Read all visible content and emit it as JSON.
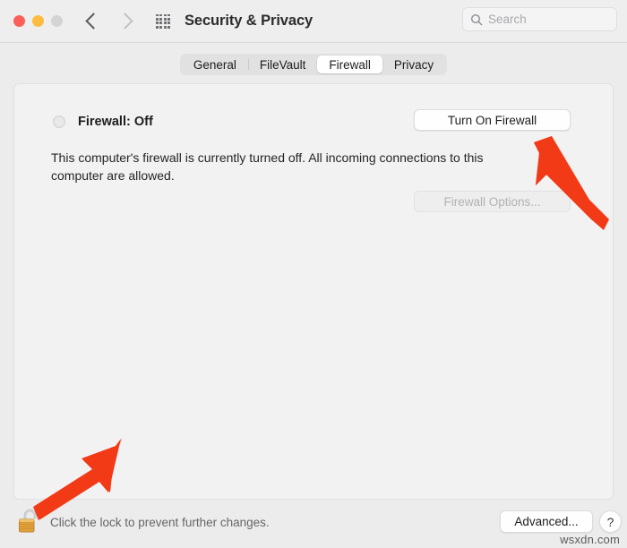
{
  "window": {
    "title": "Security & Privacy",
    "traffic_lights": [
      {
        "name": "close",
        "color": "#fc6058"
      },
      {
        "name": "minimize",
        "color": "#fdbc40"
      },
      {
        "name": "zoom",
        "color": "#d4d4d4"
      }
    ],
    "nav": {
      "back": "back-chevron",
      "forward": "forward-chevron"
    },
    "grid_icon": "show-all-grid-icon"
  },
  "search": {
    "placeholder": "Search",
    "value": "",
    "icon": "search-icon"
  },
  "tabs": [
    {
      "label": "General",
      "selected": false
    },
    {
      "label": "FileVault",
      "selected": false
    },
    {
      "label": "Firewall",
      "selected": true
    },
    {
      "label": "Privacy",
      "selected": false
    }
  ],
  "main": {
    "status_label": "Firewall: Off",
    "status_indicator": "off-status-dot",
    "description": "This computer's firewall is currently turned off. All incoming connections to this computer are allowed.",
    "turn_on_button": "Turn On Firewall",
    "firewall_options_button": "Firewall Options...",
    "firewall_options_disabled": true
  },
  "footer": {
    "lock_icon": "unlocked-padlock-icon",
    "lock_text": "Click the lock to prevent further changes.",
    "advanced_button": "Advanced...",
    "help_button": "?"
  },
  "annotations": [
    {
      "name": "arrow-to-turn-on-firewall",
      "color": "#f23a17",
      "direction": "up-left"
    },
    {
      "name": "arrow-to-lock",
      "color": "#f23a17",
      "direction": "down-left"
    }
  ],
  "watermark": "wsxdn.com",
  "colors": {
    "window_bg": "#ececec",
    "panel_bg": "#f2f2f2",
    "titlebar_bg": "#eeeeee",
    "accent_red": "#f23a17",
    "lock_gold": "#e0a33e"
  }
}
